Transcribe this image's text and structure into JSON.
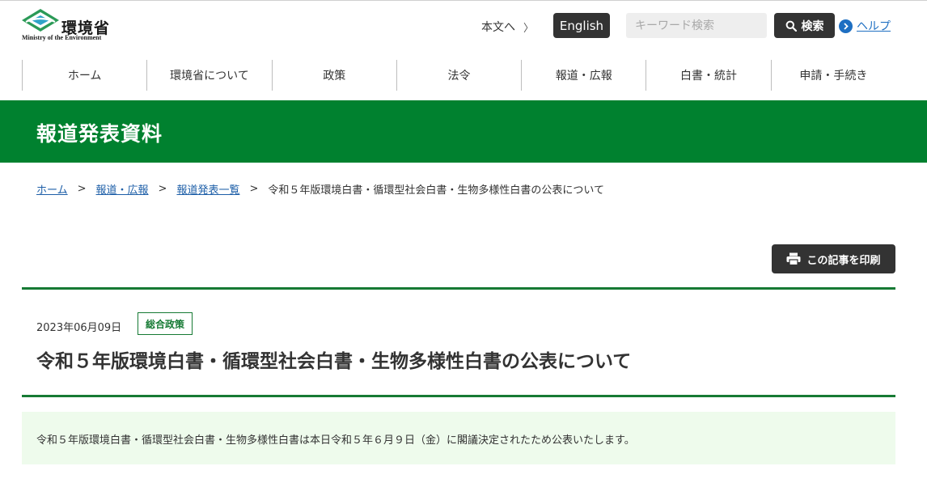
{
  "header": {
    "logo_text": "環境省",
    "logo_subtext": "Ministry of the Environment",
    "skip_link": "本文へ",
    "english_label": "English",
    "search_placeholder": "キーワード検索",
    "search_button": "検索",
    "help_label": "ヘルプ"
  },
  "nav": {
    "items": [
      "ホーム",
      "環境省について",
      "政策",
      "法令",
      "報道・広報",
      "白書・統計",
      "申請・手続き"
    ]
  },
  "banner": {
    "title": "報道発表資料"
  },
  "breadcrumb": {
    "links": [
      "ホーム",
      "報道・広報",
      "報道発表一覧"
    ],
    "separator": ">",
    "current": "令和５年版環境白書・循環型社会白書・生物多様性白書の公表について"
  },
  "print_button": "この記事を印刷",
  "article": {
    "date": "2023年06月09日",
    "category": "総合政策",
    "title": "令和５年版環境白書・循環型社会白書・生物多様性白書の公表について",
    "summary": "令和５年版環境白書・循環型社会白書・生物多様性白書は本日令和５年６月９日（金）に閣議決定されたため公表いたします。"
  },
  "colors": {
    "brand_green": "#00812f",
    "rule_green": "#167a34",
    "dark_button": "#333333",
    "link_blue": "#1e5fa8",
    "summary_bg": "#eefbec"
  },
  "icons": {
    "logo": "moe-logo-icon",
    "skip_chevron": "chevron-right-icon",
    "search": "search-icon",
    "help": "chevron-circle-icon",
    "print": "printer-icon"
  }
}
